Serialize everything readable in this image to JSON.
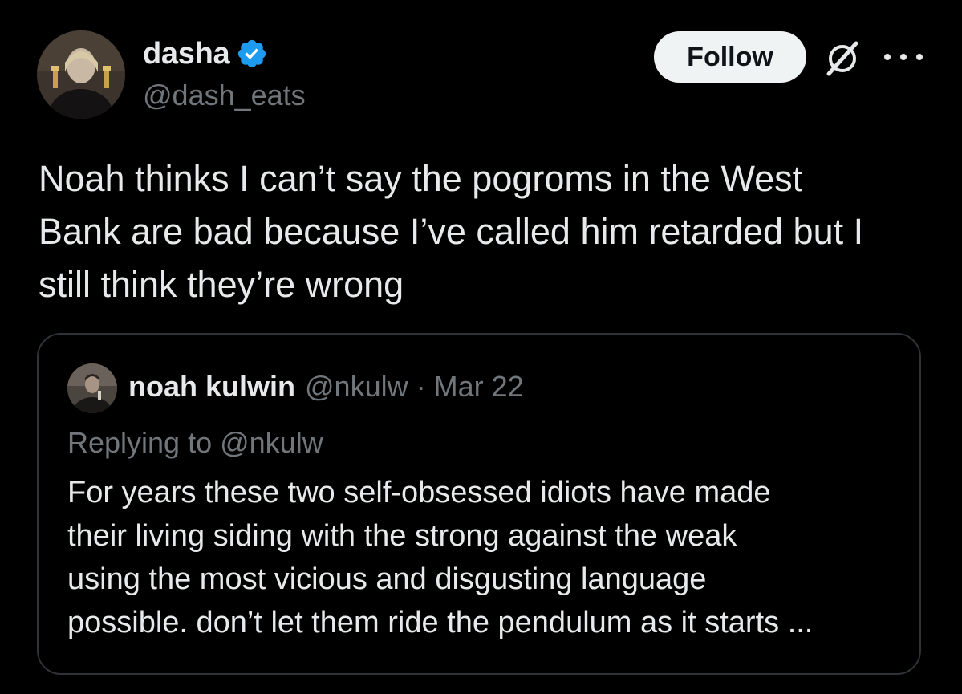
{
  "author": {
    "display_name": "dasha",
    "handle": "@dash_eats",
    "verified": true,
    "verified_icon": "verified-badge-icon",
    "avatar": "profile-photo"
  },
  "actions": {
    "follow_label": "Follow",
    "grok_icon": "grok-icon",
    "more_icon": "more-icon"
  },
  "tweet": {
    "text": "Noah thinks I can’t say the pogroms in the West\nBank are bad because I’ve called him retarded but I\nstill think they’re wrong"
  },
  "quoted_tweet": {
    "display_name": "noah kulwin",
    "handle": "@nkulw",
    "separator": "·",
    "date": "Mar 22",
    "replying_to": "Replying to @nkulw",
    "text": "For years these two self-obsessed idiots have made\ntheir living siding with the strong against the weak\nusing the most vicious and disgusting language\npossible. don’t let them ride the pendulum as it starts ..."
  },
  "colors": {
    "background": "#000000",
    "primary_text": "#e7e9ea",
    "secondary_text": "#71767b",
    "verified_blue": "#1d9bf0",
    "border": "#2f3336",
    "follow_bg": "#eff3f4"
  }
}
